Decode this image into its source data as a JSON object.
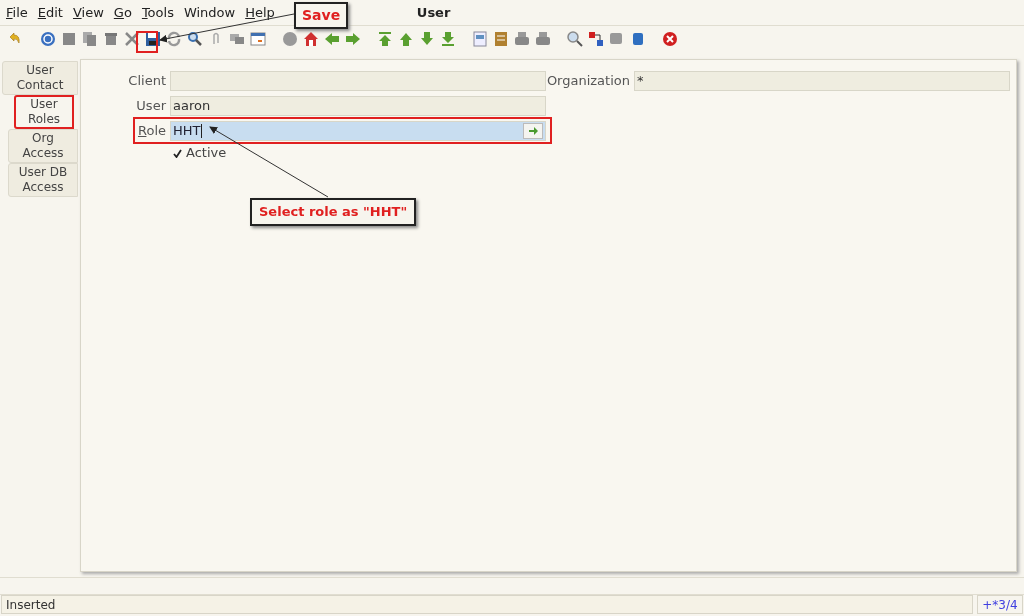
{
  "menu": [
    {
      "label": "File",
      "mnemonic": true
    },
    {
      "label": "Edit",
      "mnemonic": true
    },
    {
      "label": "View",
      "mnemonic": true
    },
    {
      "label": "Go",
      "mnemonic": true
    },
    {
      "label": "Tools",
      "mnemonic": true
    },
    {
      "label": "Window",
      "mnemonic": false
    },
    {
      "label": "Help",
      "mnemonic": true
    }
  ],
  "window": {
    "title": "User"
  },
  "tabs": [
    {
      "label": "User Contact",
      "selected": false
    },
    {
      "label": "User Roles",
      "selected": true,
      "highlighted": true
    },
    {
      "label": "Org Access",
      "selected": false
    },
    {
      "label": "User DB Access",
      "selected": false
    }
  ],
  "form": {
    "client": {
      "label": "Client"
    },
    "organization": {
      "label": "Organization",
      "value": "*"
    },
    "user": {
      "label": "User",
      "value": "aaron"
    },
    "role": {
      "label": "Role",
      "value": "HHT",
      "mnemonic": true,
      "focused": true
    },
    "active": {
      "label": "Active",
      "checked": true
    }
  },
  "annotations": [
    {
      "text": "Save"
    },
    {
      "text": "Select role as \"HHT\""
    }
  ],
  "status_bar": {
    "message": "Inserted",
    "record": "+*3/4"
  }
}
